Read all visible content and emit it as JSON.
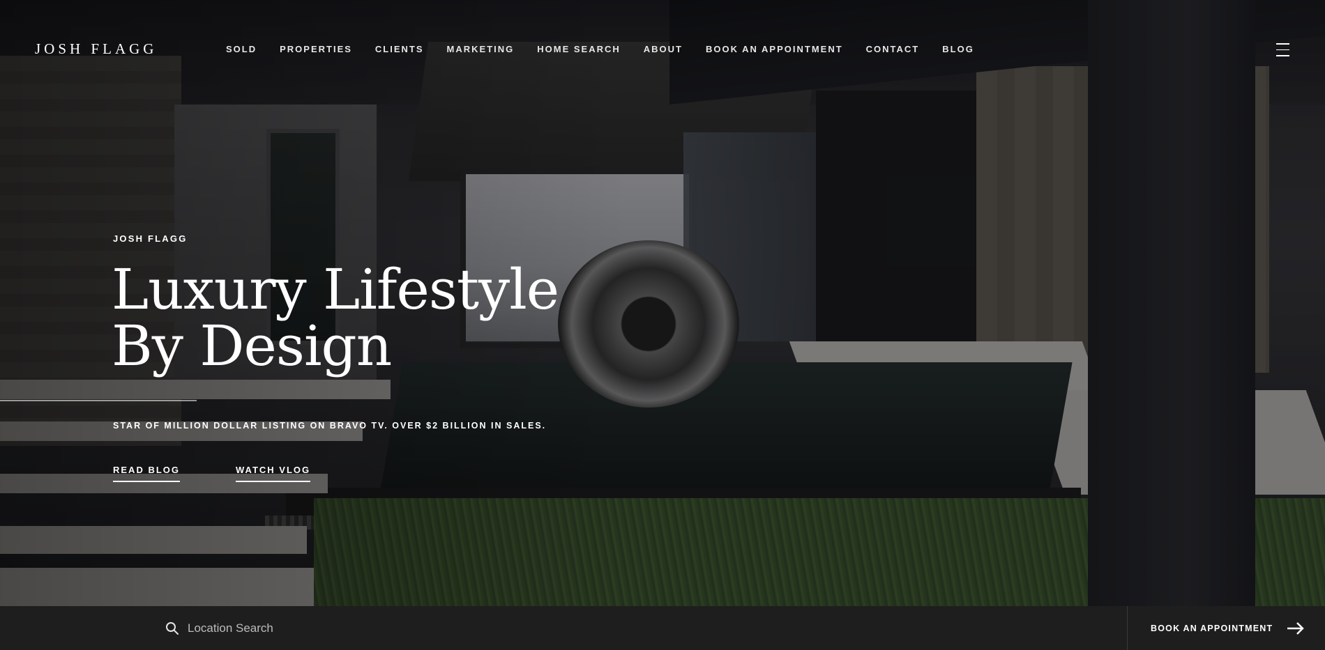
{
  "header": {
    "logo": "JOSH FLAGG",
    "nav": [
      "SOLD",
      "PROPERTIES",
      "CLIENTS",
      "MARKETING",
      "HOME SEARCH",
      "ABOUT",
      "BOOK AN APPOINTMENT",
      "CONTACT",
      "BLOG"
    ],
    "menu_icon": "hamburger-icon"
  },
  "hero": {
    "eyebrow": "JOSH FLAGG",
    "headline_line1": "Luxury Lifestyle",
    "headline_line2": "By Design",
    "tagline": "STAR OF MILLION DOLLAR LISTING ON BRAVO TV. OVER $2 BILLION IN SALES.",
    "cta_blog": "READ BLOG",
    "cta_vlog": "WATCH VLOG"
  },
  "bottom_bar": {
    "search_placeholder": "Location Search",
    "search_icon": "search-icon",
    "appointment_label": "BOOK AN APPOINTMENT",
    "appointment_icon": "arrow-right-icon"
  }
}
